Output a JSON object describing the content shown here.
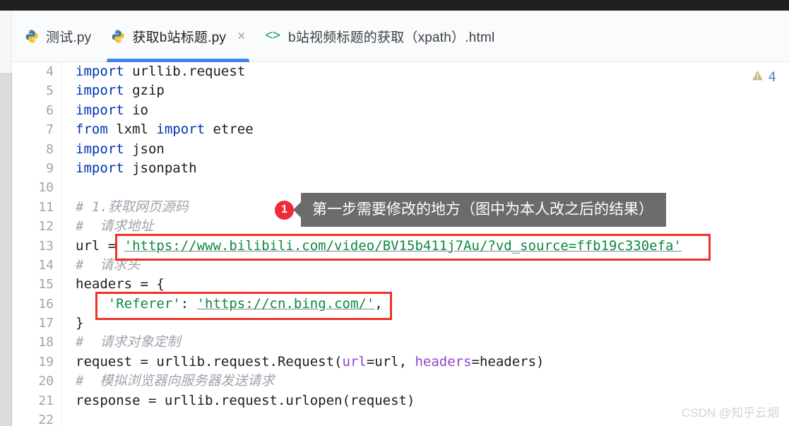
{
  "window": {
    "top_strip_color": "#1f1f1f"
  },
  "tabs": [
    {
      "label": "测试.py",
      "icon": "python-file-icon",
      "active": false,
      "closable": false,
      "kind": "python"
    },
    {
      "label": "获取b站标题.py",
      "icon": "python-file-icon",
      "active": true,
      "closable": true,
      "kind": "python",
      "close_glyph": "×"
    },
    {
      "label": "b站视频标题的获取（xpath）.html",
      "icon": "html-file-icon",
      "active": false,
      "closable": false,
      "kind": "html",
      "chevrons": "<>"
    }
  ],
  "editor": {
    "line_numbers": [
      "4",
      "5",
      "6",
      "7",
      "8",
      "9",
      "10",
      "11",
      "12",
      "13",
      "14",
      "15",
      "16",
      "17",
      "18",
      "19",
      "20",
      "21",
      "22"
    ],
    "warning": {
      "icon": "warning-triangle-icon",
      "count": "4",
      "color": "#c7b98e"
    },
    "lines": [
      {
        "n": "4",
        "segments": [
          {
            "t": "import",
            "c": "kw"
          },
          {
            "t": " urllib.request",
            "c": "plain"
          }
        ]
      },
      {
        "n": "5",
        "segments": [
          {
            "t": "import",
            "c": "kw"
          },
          {
            "t": " gzip",
            "c": "plain"
          }
        ]
      },
      {
        "n": "6",
        "segments": [
          {
            "t": "import",
            "c": "kw"
          },
          {
            "t": " io",
            "c": "plain"
          }
        ]
      },
      {
        "n": "7",
        "segments": [
          {
            "t": "from",
            "c": "kw"
          },
          {
            "t": " lxml ",
            "c": "plain"
          },
          {
            "t": "import",
            "c": "kw"
          },
          {
            "t": " etree",
            "c": "plain"
          }
        ]
      },
      {
        "n": "8",
        "segments": [
          {
            "t": "import",
            "c": "kw"
          },
          {
            "t": " json",
            "c": "plain"
          }
        ]
      },
      {
        "n": "9",
        "segments": [
          {
            "t": "import",
            "c": "kw"
          },
          {
            "t": " jsonpath",
            "c": "plain"
          }
        ]
      },
      {
        "n": "10",
        "segments": [
          {
            "t": "",
            "c": "plain"
          }
        ]
      },
      {
        "n": "11",
        "segments": [
          {
            "t": "# 1.获取网页源码",
            "c": "cmt"
          }
        ]
      },
      {
        "n": "12",
        "segments": [
          {
            "t": "#  请求地址",
            "c": "cmt"
          }
        ]
      },
      {
        "n": "13",
        "segments": [
          {
            "t": "url = ",
            "c": "plain"
          },
          {
            "t": "'https://www.bilibili.com/video/BV15b411j7Au/?vd_source=ffb19c330efa'",
            "c": "str-link"
          }
        ]
      },
      {
        "n": "14",
        "segments": [
          {
            "t": "#  请求头",
            "c": "cmt"
          }
        ]
      },
      {
        "n": "15",
        "segments": [
          {
            "t": "headers = {",
            "c": "plain"
          }
        ]
      },
      {
        "n": "16",
        "segments": [
          {
            "t": "    ",
            "c": "plain"
          },
          {
            "t": "'Referer'",
            "c": "str"
          },
          {
            "t": ": ",
            "c": "plain"
          },
          {
            "t": "'https://cn.bing.com/'",
            "c": "str-link"
          },
          {
            "t": ",",
            "c": "plain"
          }
        ]
      },
      {
        "n": "17",
        "segments": [
          {
            "t": "}",
            "c": "plain"
          }
        ]
      },
      {
        "n": "18",
        "segments": [
          {
            "t": "#  请求对象定制",
            "c": "cmt"
          }
        ]
      },
      {
        "n": "19",
        "segments": [
          {
            "t": "request = urllib.request.Request(",
            "c": "plain"
          },
          {
            "t": "url",
            "c": "kwarg"
          },
          {
            "t": "=url, ",
            "c": "plain"
          },
          {
            "t": "headers",
            "c": "kwarg"
          },
          {
            "t": "=headers)",
            "c": "plain"
          }
        ]
      },
      {
        "n": "20",
        "segments": [
          {
            "t": "#  模拟浏览器向服务器发送请求",
            "c": "cmt"
          }
        ]
      },
      {
        "n": "21",
        "segments": [
          {
            "t": "response = urllib.request.urlopen(request)",
            "c": "plain"
          }
        ]
      },
      {
        "n": "22",
        "segments": [
          {
            "t": "",
            "c": "plain"
          }
        ]
      }
    ]
  },
  "annotations": {
    "callout": {
      "badge": "1",
      "text": "第一步需要修改的地方（图中为本人改之后的结果）",
      "bubble_color": "#6b6b6b",
      "badge_color": "#ee2b39"
    },
    "highlight_boxes": [
      {
        "name": "url-highlight",
        "color": "#f03127",
        "target_line": "13"
      },
      {
        "name": "referer-highlight",
        "color": "#f03127",
        "target_line": "16"
      }
    ]
  },
  "watermark": {
    "text": "CSDN @知乎云烟"
  },
  "colors": {
    "accent_blue": "#4284f3",
    "keyword_blue": "#0033b3",
    "string_green": "#0b8a3e",
    "comment_gray": "#9da3ad",
    "kwarg_purple": "#8e44c9",
    "red_box": "#f03127"
  }
}
